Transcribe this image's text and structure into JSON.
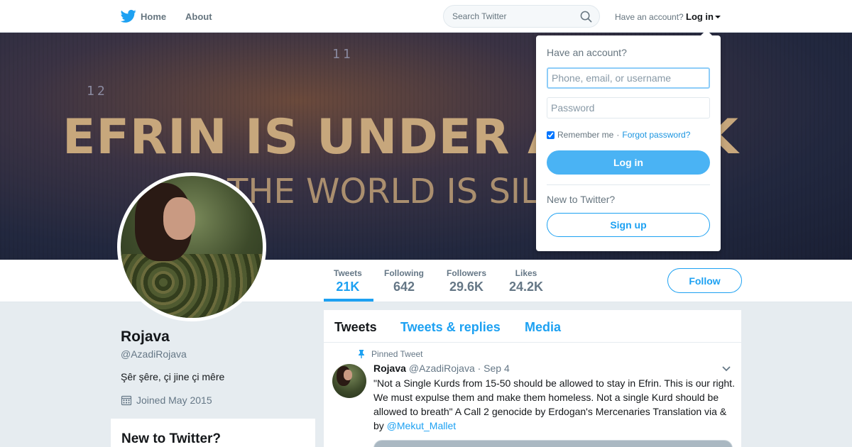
{
  "nav": {
    "home_label": "Home",
    "about_label": "About",
    "search_placeholder": "Search Twitter",
    "have_account": "Have an account?",
    "login_label": "Log in"
  },
  "banner": {
    "num1": "11",
    "num2": "12",
    "line1": "EFRIN IS UNDER ATTACK",
    "line2": "THE WORLD IS SILENT"
  },
  "stats": [
    {
      "label": "Tweets",
      "value": "21K",
      "active": true
    },
    {
      "label": "Following",
      "value": "642"
    },
    {
      "label": "Followers",
      "value": "29.6K"
    },
    {
      "label": "Likes",
      "value": "24.2K"
    }
  ],
  "follow_label": "Follow",
  "profile": {
    "name": "Rojava",
    "handle": "@AzadiRojava",
    "bio": "Şêr şêre, çi jine çi mêre",
    "joined": "Joined May 2015"
  },
  "sidebar": {
    "new_title": "New to Twitter?"
  },
  "timeline": {
    "tabs": [
      "Tweets",
      "Tweets & replies",
      "Media"
    ],
    "pinned_label": "Pinned Tweet",
    "tweet": {
      "name": "Rojava",
      "meta": "@AzadiRojava · Sep 4",
      "text": "\"Not a Single Kurds from 15-50 should be allowed to stay in Efrin. This  is our right. We must expulse them and make them homeless. Not a single  Kurd should be allowed to breath\" A Call 2 genocide by Erdogan's Mercenaries Translation via & by ",
      "mention": "@Mekut_Mallet"
    }
  },
  "login_dropdown": {
    "title": "Have an account?",
    "username_placeholder": "Phone, email, or username",
    "password_placeholder": "Password",
    "remember_label": "Remember me",
    "separator": "·",
    "forgot_label": "Forgot password?",
    "login_button": "Log in",
    "new_label": "New to Twitter?",
    "signup_button": "Sign up"
  },
  "colors": {
    "accent": "#1da1f2",
    "login_button_bg": "#4ab3f4",
    "page_bg": "#e6ecf0"
  }
}
